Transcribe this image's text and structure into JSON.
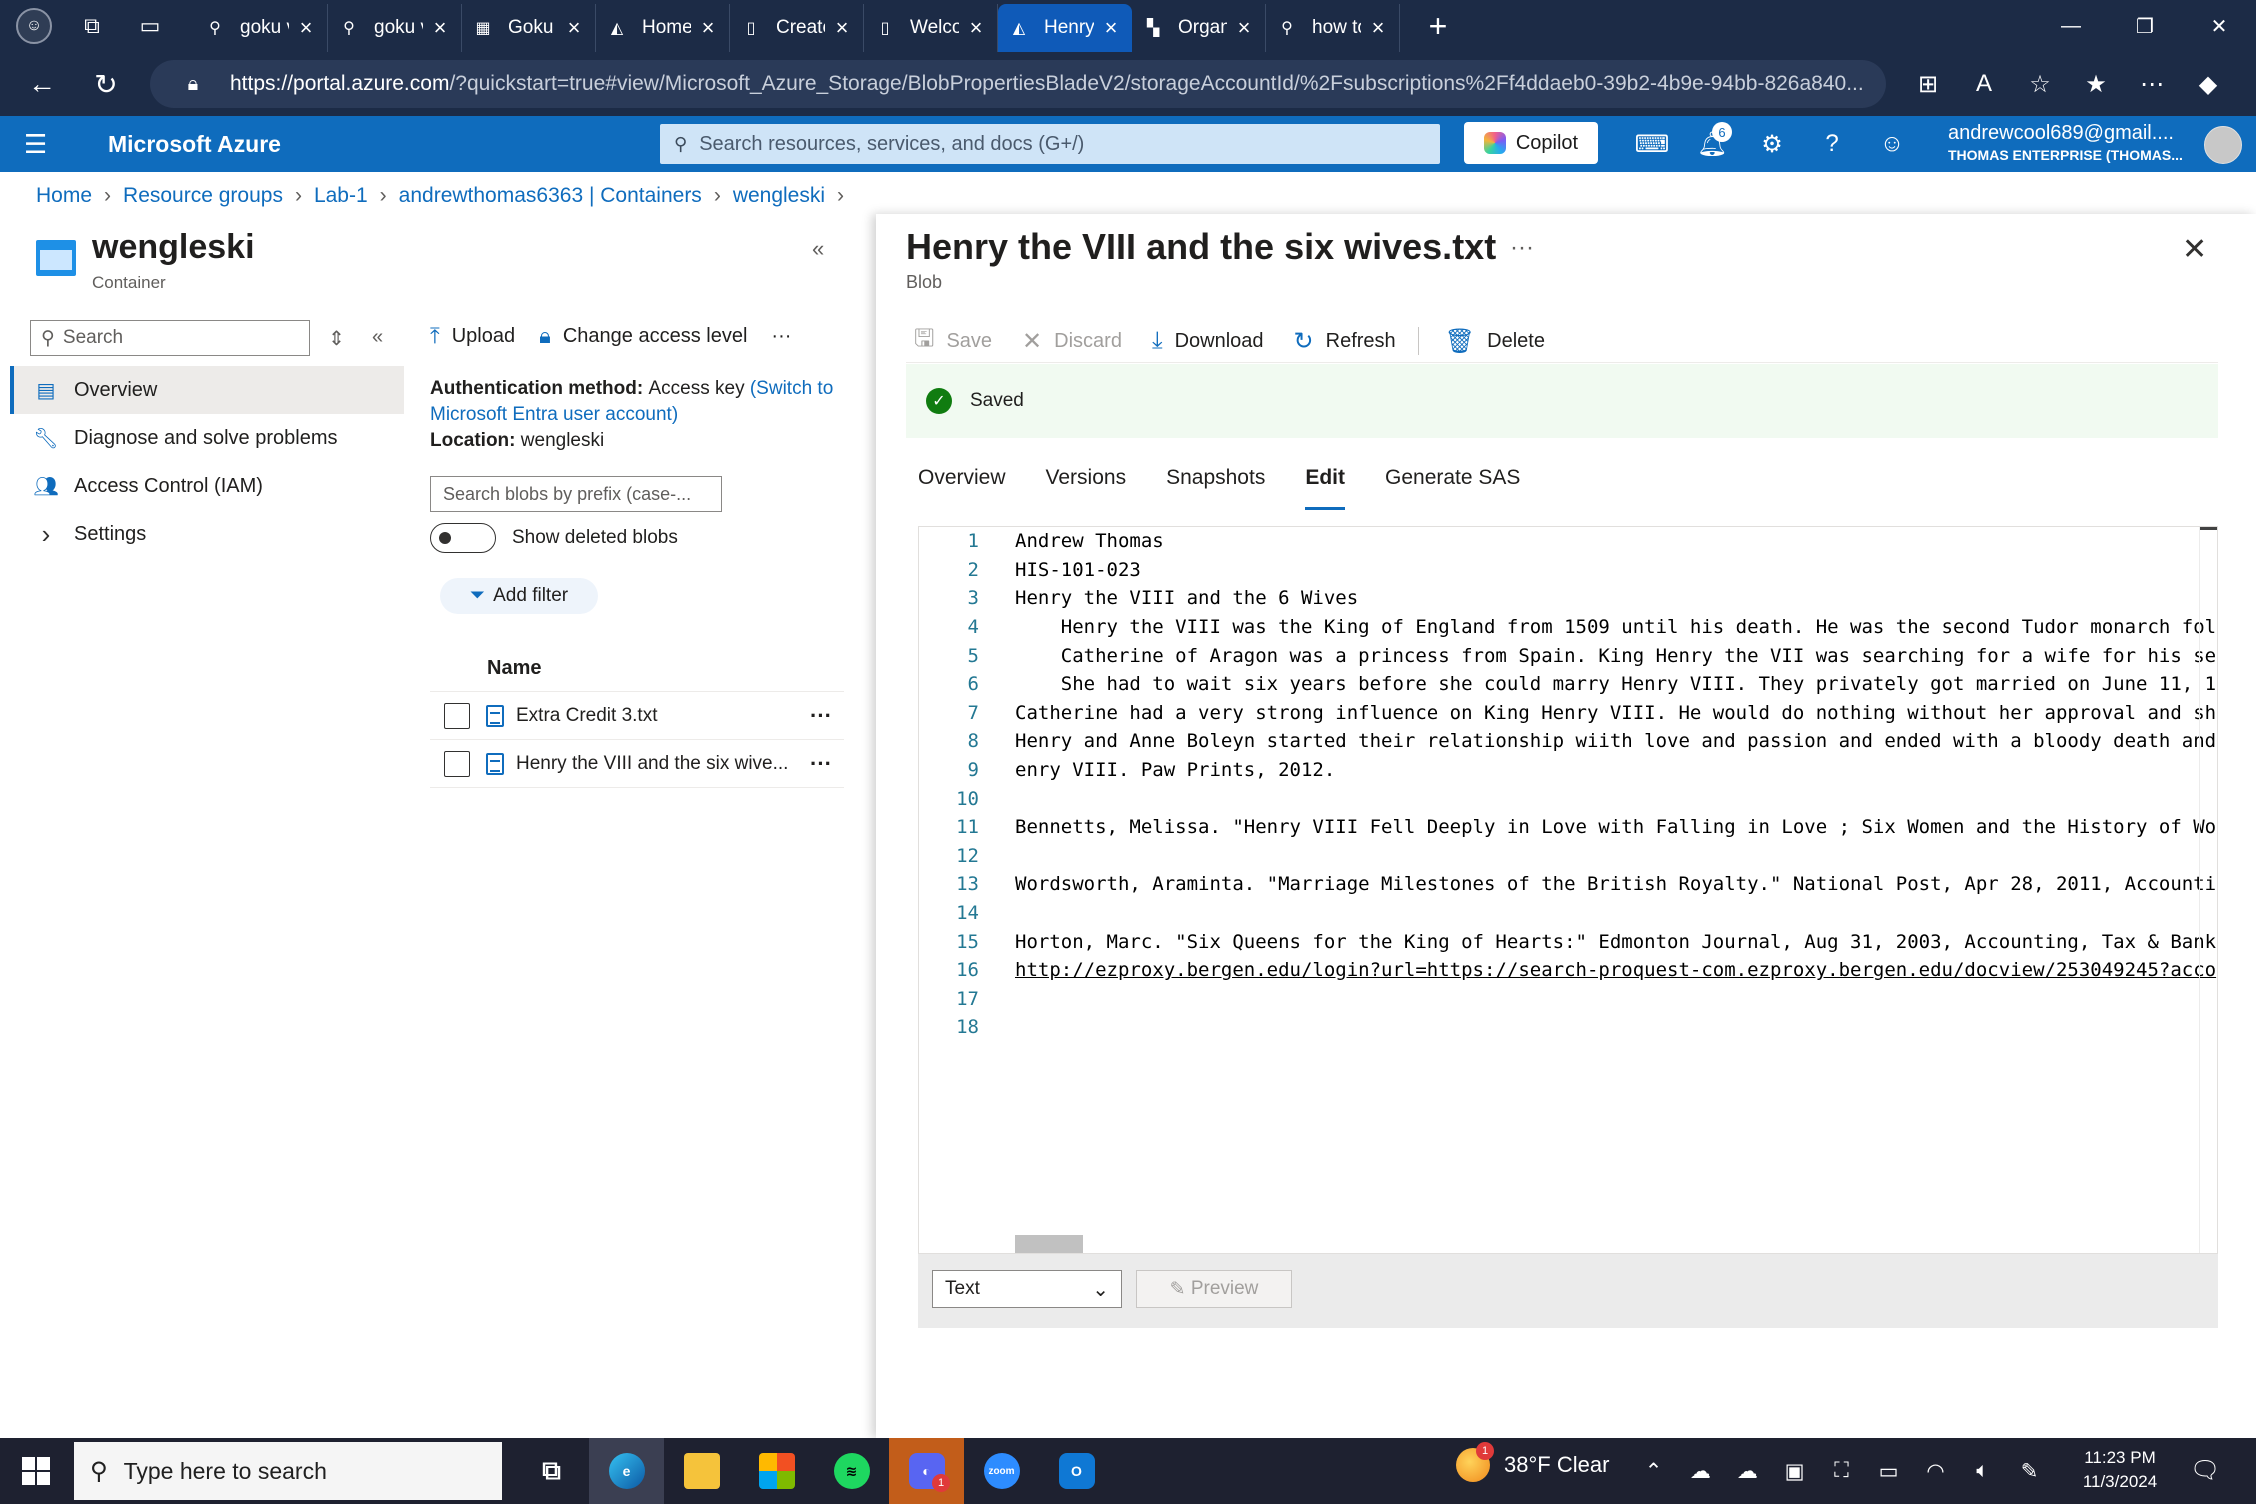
{
  "browser": {
    "tabs": [
      {
        "label": "goku vegeta",
        "icon": "search-icon",
        "active": false
      },
      {
        "label": "goku vegeta",
        "icon": "search-icon",
        "active": false
      },
      {
        "label": "Goku & Vegeta",
        "icon": "site-icon",
        "active": false
      },
      {
        "label": "Home - Microsoft Azure",
        "icon": "azure-icon",
        "active": false
      },
      {
        "label": "Create Your Account",
        "icon": "page-icon",
        "active": false
      },
      {
        "label": "Welcome to",
        "icon": "page-icon",
        "active": false
      },
      {
        "label": "Henry the VIII",
        "icon": "azure-icon",
        "active": true
      },
      {
        "label": "Organize your",
        "icon": "microsoft-icon",
        "active": false
      },
      {
        "label": "how to take",
        "icon": "search-icon",
        "active": false
      }
    ],
    "url_host": "https://portal.azure.com",
    "url_rest": "/?quickstart=true#view/Microsoft_Azure_Storage/BlobPropertiesBladeV2/storageAccountId/%2Fsubscriptions%2Ff4ddaeb0-39b2-4b9e-94bb-826a840...",
    "extension_badge": "1"
  },
  "azure": {
    "brand": "Microsoft Azure",
    "search_placeholder": "Search resources, services, and docs (G+/)",
    "copilot_label": "Copilot",
    "notification_count": "6",
    "user_email": "andrewcool689@gmail....",
    "user_tenant": "THOMAS ENTERPRISE (THOMAS..."
  },
  "breadcrumb": [
    "Home",
    "Resource groups",
    "Lab-1",
    "andrewthomas6363 | Containers",
    "wengleski"
  ],
  "resource": {
    "title": "wengleski",
    "subtitle": "Container",
    "search_placeholder": "Search",
    "menu": [
      {
        "label": "Overview",
        "icon": "overview-icon",
        "selected": true
      },
      {
        "label": "Diagnose and solve problems",
        "icon": "wrench-icon",
        "selected": false
      },
      {
        "label": "Access Control (IAM)",
        "icon": "people-icon",
        "selected": false
      },
      {
        "label": "Settings",
        "icon": "chevron-right-icon",
        "selected": false
      }
    ]
  },
  "container": {
    "upload_label": "Upload",
    "change_access_label": "Change access level",
    "auth_label": "Authentication method:",
    "auth_value": "Access key",
    "auth_link": "(Switch to Microsoft Entra user account)",
    "location_label": "Location:",
    "location_value": "wengleski",
    "prefix_placeholder": "Search blobs by prefix (case-...",
    "show_deleted_label": "Show deleted blobs",
    "add_filter_label": "Add filter",
    "name_header": "Name",
    "blobs": [
      "Extra Credit 3.txt",
      "Henry the VIII and the six wive..."
    ]
  },
  "blade": {
    "title": "Henry the VIII and the six wives.txt",
    "subtitle": "Blob",
    "tools": {
      "save": "Save",
      "discard": "Discard",
      "download": "Download",
      "refresh": "Refresh",
      "delete": "Delete"
    },
    "saved_message": "Saved",
    "tabs": [
      "Overview",
      "Versions",
      "Snapshots",
      "Edit",
      "Generate SAS"
    ],
    "active_tab": "Edit",
    "editor_lines": [
      "Andrew Thomas",
      "HIS-101-023",
      "Henry the VIII and the 6 Wives",
      "    Henry the VIII was the King of England from 1509 until his death. He was the second Tudor monarch fol",
      "    Catherine of Aragon was a princess from Spain. King Henry the VII was searching for a wife for his se",
      "    She had to wait six years before she could marry Henry VIII. They privately got married on June 11, 1",
      "Catherine had a very strong influence on King Henry VIII. He would do nothing without her approval and sh",
      "Henry and Anne Boleyn started their relationship wiith love and passion and ended with a bloody death and",
      "enry VIII. Paw Prints, 2012.",
      "",
      "Bennetts, Melissa. \"Henry VIII Fell Deeply in Love with Falling in Love ; Six Women and the History of Wo",
      "",
      "Wordsworth, Araminta. \"Marriage Milestones of the British Royalty.\" National Post, Apr 28, 2011, Accounti",
      "",
      "Horton, Marc. \"Six Queens for the King of Hearts:\" Edmonton Journal, Aug 31, 2003, Accounting, Tax & Bank",
      "http://ezproxy.bergen.edu/login?url=https://search-proquest-com.ezproxy.bergen.edu/docview/253049245?acco",
      "",
      ""
    ],
    "format_value": "Text",
    "preview_label": "Preview"
  },
  "taskbar": {
    "search_placeholder": "Type here to search",
    "weather_temp": "38°F",
    "weather_cond": "Clear",
    "weather_badge": "1",
    "discord_badge": "1",
    "time": "11:23 PM",
    "date": "11/3/2024"
  }
}
